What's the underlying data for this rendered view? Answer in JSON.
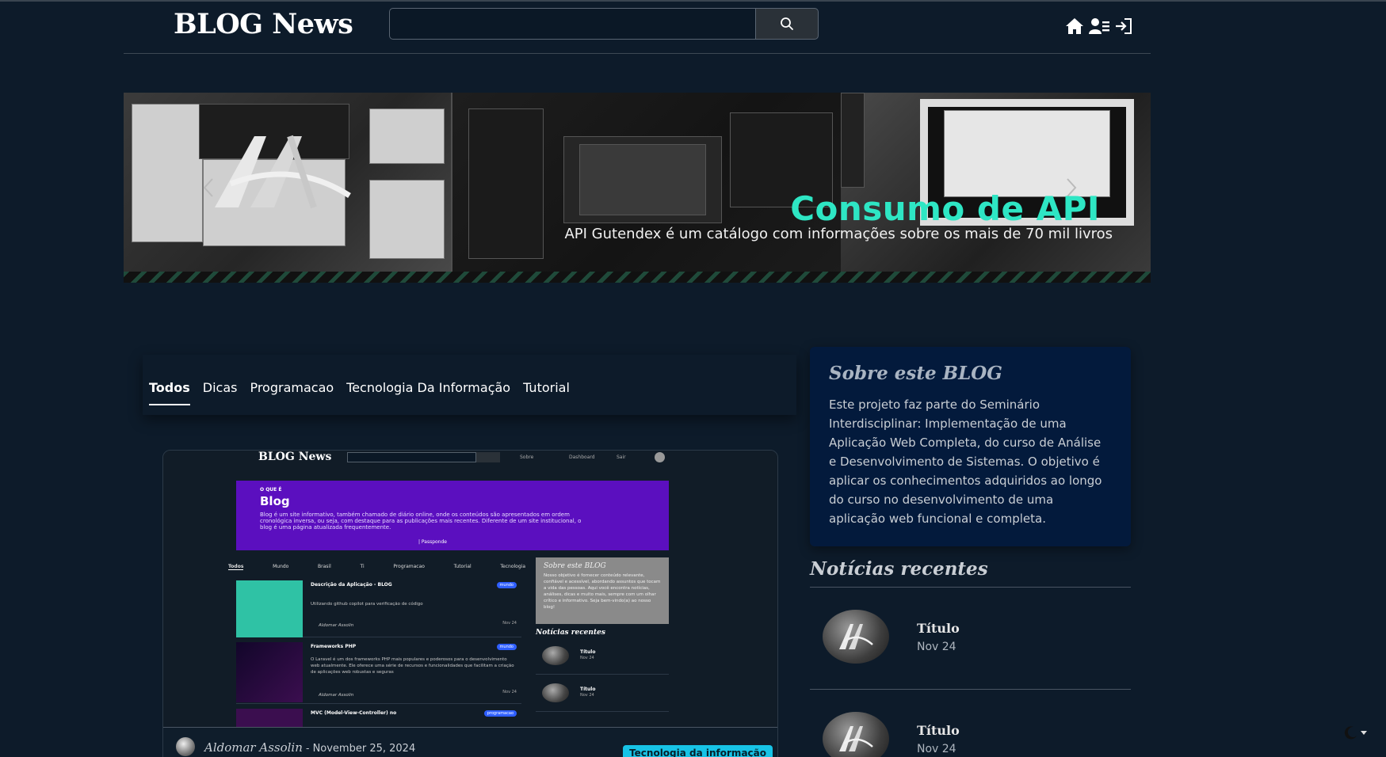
{
  "header": {
    "logo": "BLOG News",
    "search_placeholder": "",
    "icons": [
      "home-icon",
      "user-card-icon",
      "sign-in-icon"
    ]
  },
  "banner": {
    "title": "Consumo de API",
    "subtitle": "API Gutendex é um catálogo com informações sobre os mais de 70 mil livros"
  },
  "tabs": [
    {
      "label": "Todos",
      "active": true
    },
    {
      "label": "Dicas",
      "active": false
    },
    {
      "label": "Programacao",
      "active": false
    },
    {
      "label": "Tecnologia Da Informação",
      "active": false
    },
    {
      "label": "Tutorial",
      "active": false
    }
  ],
  "post": {
    "author": "Aldomar Assolin",
    "separator": " - ",
    "date": "November 25, 2024",
    "badge": "Tecnologia da informação",
    "thumbnail": {
      "logo": "BLOG News",
      "nav": [
        "Sobre",
        "Dashboard",
        "Sair"
      ],
      "hero_kicker": "O QUE É",
      "hero_title": "Blog",
      "hero_text": "Blog é um site informativo, também chamado de diário online, onde os conteúdos são apresentados em ordem cronológica inversa, ou seja, com destaque para as publicações mais recentes. Diferente de um site institucional, o blog é uma página atualizada frequentemente.",
      "hero_brand": "| Passponde",
      "tabs": [
        "Todos",
        "Mundo",
        "Brasil",
        "Ti",
        "Programacao",
        "Tutorial",
        "Tecnologia"
      ],
      "posts": [
        {
          "title": "Descrição da Aplicação - BLOG",
          "tag": "mundo",
          "desc": "Utilizando github copilot para verificação de código",
          "author": "Aldomar Assolin",
          "date": "Nov 24"
        },
        {
          "title": "Frameworks PHP",
          "tag": "mundo",
          "desc": "O Laravel é um dos frameworks PHP mais populares e poderosos para o desenvolvimento web atualmente. Ele oferece uma série de recursos e funcionalidades que facilitam a criação de aplicações web robustas e seguras",
          "author": "Aldomar Assolin",
          "date": "Nov 24"
        },
        {
          "title": "MVC (Model-View-Controller) no",
          "tag": "programacao",
          "desc": "",
          "author": "",
          "date": ""
        }
      ],
      "about_title": "Sobre este BLOG",
      "about_text": "Nosso objetivo é fornecer conteúdo relevante, confiável e acessível, abordando assuntos que tocam a vida das pessoas. Aqui você encontra notícias, análises, dicas e muito mais, sempre com um olhar crítico e informativo. Seja bem-vindo(a) ao nosso blog!",
      "recent_title": "Notícias recentes",
      "recent": [
        {
          "title": "Título",
          "date": "Nov 24"
        },
        {
          "title": "Título",
          "date": "Nov 24"
        }
      ]
    }
  },
  "sidebar": {
    "about_title": "Sobre este BLOG",
    "about_text": "Este projeto faz parte do Seminário Interdisciplinar: Implementação de uma Aplicação Web Completa, do curso de Análise e Desenvolvimento de Sistemas. O objetivo é aplicar os conhecimentos adquiridos ao longo do curso no desenvolvimento de uma aplicação web funcional e completa.",
    "recent_title": "Notícias recentes",
    "recent": [
      {
        "title": "Título",
        "date": "Nov 24"
      },
      {
        "title": "Título",
        "date": "Nov 24"
      }
    ]
  },
  "colors": {
    "background": "#0d1b2a",
    "about_bg": "#031a3c",
    "banner_accent": "#2ee6c4",
    "badge": "#17c3e6"
  }
}
